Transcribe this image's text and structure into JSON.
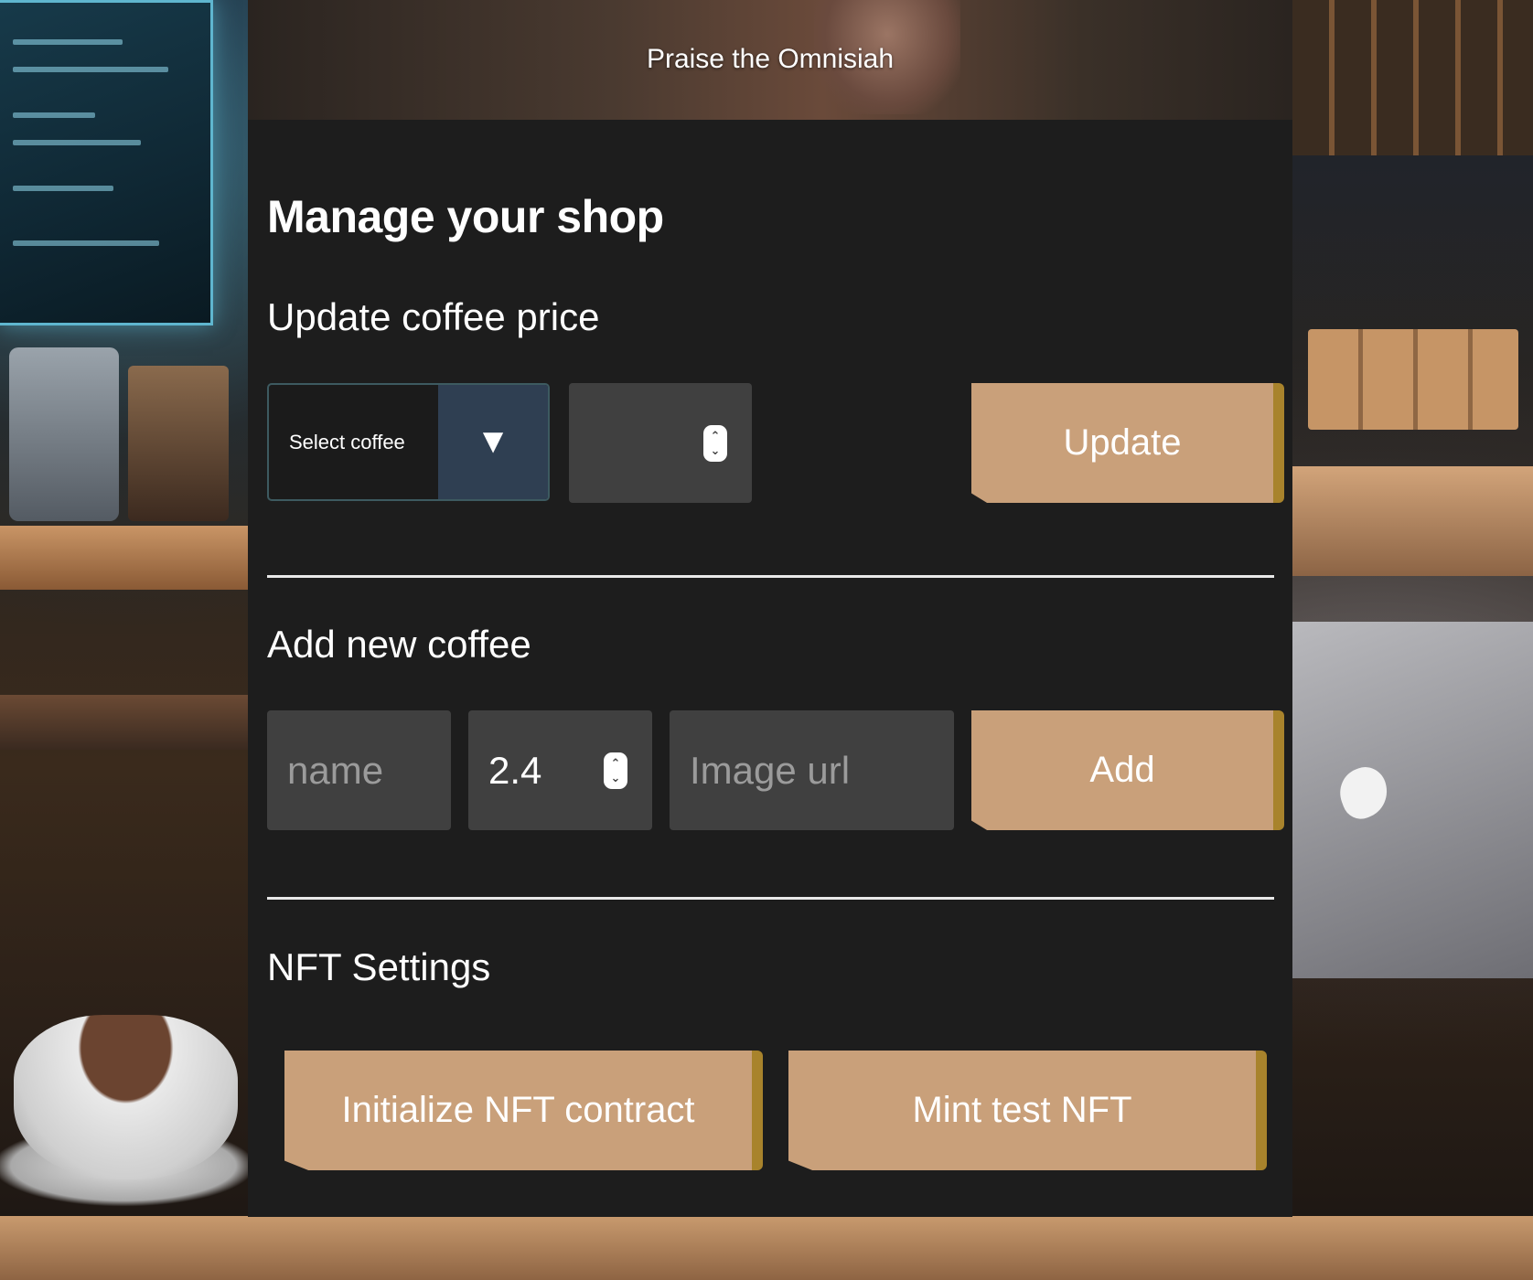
{
  "header": {
    "title": "Praise the Omnisiah"
  },
  "page": {
    "title": "Manage your shop"
  },
  "update_price": {
    "heading": "Update coffee price",
    "select_label": "Select coffee",
    "select_arrow": "▼",
    "price_value": "",
    "button_label": "Update"
  },
  "add_coffee": {
    "heading": "Add new coffee",
    "name_placeholder": "name",
    "price_value": "2.4",
    "image_placeholder": "Image url",
    "button_label": "Add"
  },
  "nft": {
    "heading": "NFT Settings",
    "init_button_label": "Initialize NFT contract",
    "mint_button_label": "Mint test NFT"
  },
  "colors": {
    "panel_bg": "#1d1d1d",
    "button_bg": "#c9a07a",
    "button_edge": "#a8832c",
    "input_bg": "#404040",
    "select_arrow_bg": "#2f3f52"
  },
  "icons": {
    "spinner": "up-down-stepper-icon",
    "select": "triangle-down-icon"
  }
}
